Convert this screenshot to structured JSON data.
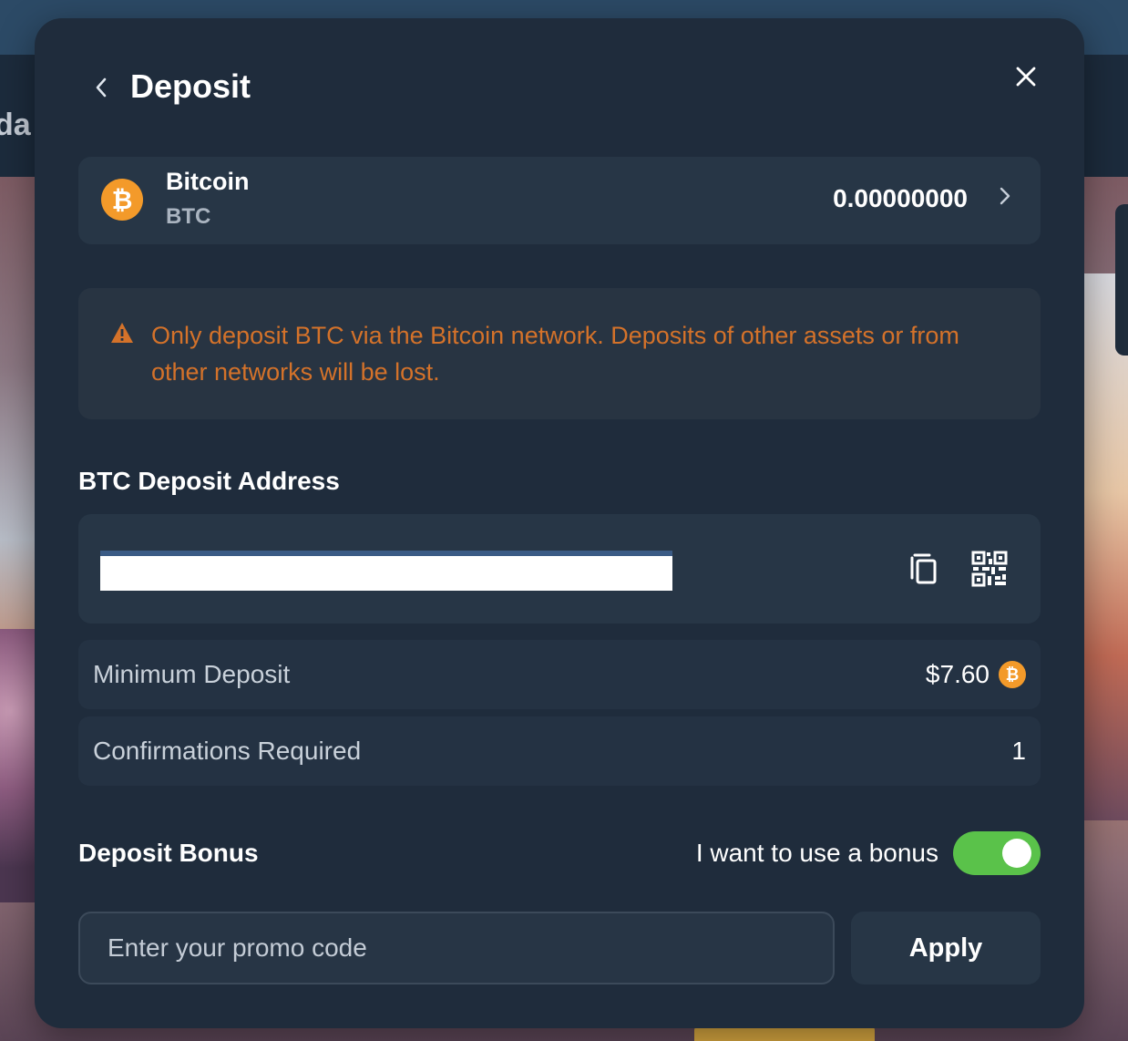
{
  "background": {
    "nav_text": "da"
  },
  "modal": {
    "title": "Deposit",
    "back_icon": "chevron-left-icon",
    "close_icon": "close-icon"
  },
  "currency": {
    "name": "Bitcoin",
    "symbol": "BTC",
    "logo_glyph": "₿",
    "balance": "0.00000000",
    "chevron_icon": "chevron-right-icon"
  },
  "warning": {
    "icon": "warning-triangle-icon",
    "text": "Only deposit BTC via the Bitcoin network. Deposits of other assets or from other networks will be lost.",
    "color": "#d4722a"
  },
  "address": {
    "label": "BTC Deposit Address",
    "value": "",
    "copy_icon": "copy-icon",
    "qr_icon": "qr-code-icon"
  },
  "info": {
    "min_deposit_label": "Minimum Deposit",
    "min_deposit_value": "$7.60",
    "min_deposit_coin_glyph": "₿",
    "confirmations_label": "Confirmations Required",
    "confirmations_value": "1"
  },
  "bonus": {
    "label": "Deposit Bonus",
    "toggle_label": "I want to use a bonus",
    "toggle_on": true,
    "toggle_color": "#5ac24a",
    "promo_placeholder": "Enter your promo code",
    "promo_value": "",
    "apply_label": "Apply"
  }
}
